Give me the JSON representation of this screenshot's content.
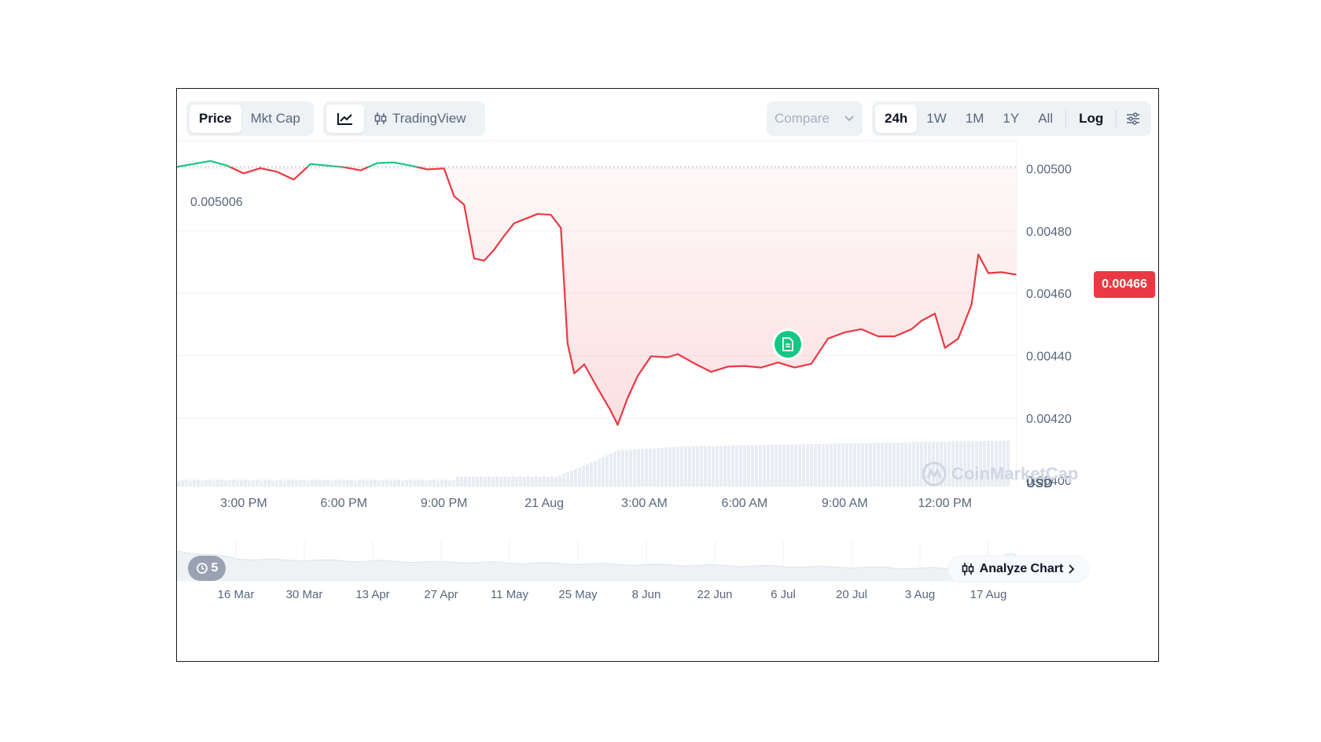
{
  "toolbar": {
    "type_tabs": [
      {
        "label": "Price",
        "active": true
      },
      {
        "label": "Mkt Cap",
        "active": false
      }
    ],
    "style_tabs": {
      "line_icon": "line-chart-icon",
      "tradingview_label": "TradingView"
    },
    "compare_label": "Compare",
    "range_tabs": [
      {
        "label": "24h",
        "active": true
      },
      {
        "label": "1W",
        "active": false
      },
      {
        "label": "1M",
        "active": false
      },
      {
        "label": "1Y",
        "active": false
      },
      {
        "label": "All",
        "active": false
      }
    ],
    "log_label": "Log",
    "settings_icon": "sliders-icon"
  },
  "chart": {
    "open_price_label": "0.005006",
    "current_price_label": "0.00466",
    "currency_label": "USD",
    "watermark": "CoinMarketCap",
    "analyze_label": "Analyze Chart",
    "history_count": "5",
    "colors": {
      "up": "#16c784",
      "down": "#ea3943",
      "badge": "#ea3943",
      "grid": "#eff2f5"
    }
  },
  "chart_data": {
    "type": "line",
    "y_ticks": [
      "0.00500",
      "0.00480",
      "0.00460",
      "0.00440",
      "0.00420",
      "0.00400"
    ],
    "y_tick_values": [
      0.005,
      0.0048,
      0.0046,
      0.0044,
      0.0042,
      0.004
    ],
    "ylim": [
      0.00398,
      0.00509
    ],
    "x_ticks": [
      "3:00 PM",
      "6:00 PM",
      "9:00 PM",
      "21 Aug",
      "3:00 AM",
      "6:00 AM",
      "9:00 AM",
      "12:00 PM"
    ],
    "x_hours": [
      3,
      6,
      9,
      12,
      15,
      18,
      21,
      24
    ],
    "xlim": [
      1,
      26.15
    ],
    "baseline": 0.005006,
    "series": [
      {
        "points": [
          [
            1.0,
            0.005006
          ],
          [
            2.0,
            0.005025
          ],
          [
            2.5,
            0.00501
          ],
          [
            3.0,
            0.004985
          ],
          [
            3.5,
            0.005002
          ],
          [
            4.0,
            0.00499
          ],
          [
            4.5,
            0.004965
          ],
          [
            5.0,
            0.005015
          ],
          [
            5.5,
            0.00501
          ],
          [
            6.0,
            0.005005
          ],
          [
            6.5,
            0.004995
          ],
          [
            7.0,
            0.005018
          ],
          [
            7.5,
            0.00502
          ],
          [
            8.0,
            0.00501
          ],
          [
            8.5,
            0.004998
          ],
          [
            9.0,
            0.005001
          ],
          [
            9.3,
            0.004912
          ],
          [
            9.6,
            0.004885
          ],
          [
            9.9,
            0.004712
          ],
          [
            10.2,
            0.004705
          ],
          [
            10.5,
            0.00474
          ],
          [
            10.8,
            0.004785
          ],
          [
            11.1,
            0.004825
          ],
          [
            11.5,
            0.004842
          ],
          [
            11.8,
            0.004855
          ],
          [
            12.2,
            0.004852
          ],
          [
            12.5,
            0.00481
          ],
          [
            12.7,
            0.00444
          ],
          [
            12.9,
            0.004343
          ],
          [
            13.2,
            0.004372
          ],
          [
            13.6,
            0.004295
          ],
          [
            14.0,
            0.004222
          ],
          [
            14.2,
            0.004178
          ],
          [
            14.5,
            0.004265
          ],
          [
            14.8,
            0.004335
          ],
          [
            15.2,
            0.004398
          ],
          [
            15.7,
            0.004395
          ],
          [
            16.0,
            0.004405
          ],
          [
            16.5,
            0.004375
          ],
          [
            17.0,
            0.004348
          ],
          [
            17.5,
            0.004365
          ],
          [
            18.0,
            0.004367
          ],
          [
            18.5,
            0.004362
          ],
          [
            19.0,
            0.004378
          ],
          [
            19.5,
            0.004362
          ],
          [
            20.0,
            0.004374
          ],
          [
            20.5,
            0.004455
          ],
          [
            21.0,
            0.004475
          ],
          [
            21.5,
            0.004485
          ],
          [
            22.0,
            0.004462
          ],
          [
            22.5,
            0.004462
          ],
          [
            23.0,
            0.004485
          ],
          [
            23.3,
            0.004512
          ],
          [
            23.7,
            0.004535
          ],
          [
            24.0,
            0.004425
          ],
          [
            24.4,
            0.004455
          ],
          [
            24.8,
            0.004565
          ],
          [
            25.0,
            0.004725
          ],
          [
            25.3,
            0.004665
          ],
          [
            25.7,
            0.004668
          ],
          [
            26.15,
            0.00466
          ]
        ]
      }
    ],
    "navigator": {
      "x_ticks": [
        "16 Mar",
        "30 Mar",
        "13 Apr",
        "27 Apr",
        "11 May",
        "25 May",
        "8 Jun",
        "22 Jun",
        "6 Jul",
        "20 Jul",
        "3 Aug",
        "17 Aug"
      ]
    }
  }
}
